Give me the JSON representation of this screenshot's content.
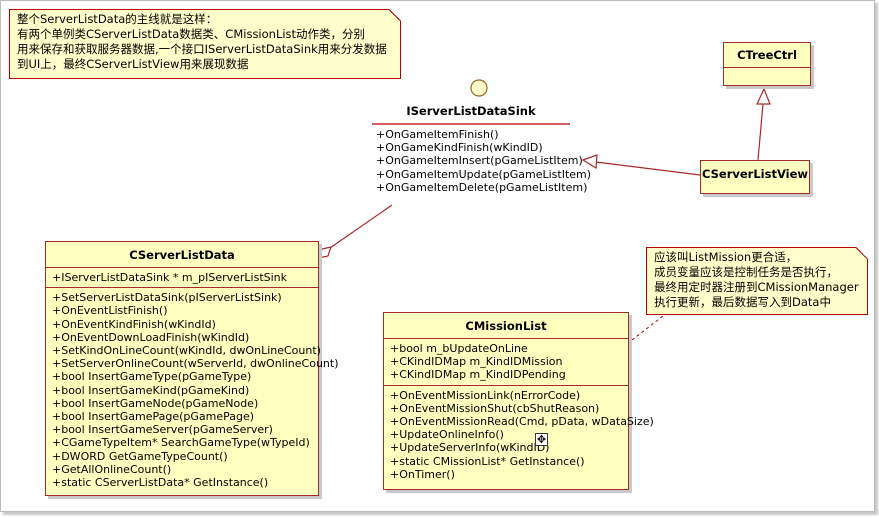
{
  "notes": {
    "summary": [
      "整个ServerListData的主线就是这样：",
      "有两个单例类CServerListData数据类、CMissionList动作类，分别",
      "用来保存和获取服务器数据,一个接口IServerListDataSink用来分发数据",
      "到UI上，最终CServerListView用来展现数据"
    ],
    "mission": [
      "应该叫ListMission更合适，",
      "成员变量应该是控制任务是否执行，",
      "最终用定时器注册到CMissionManager",
      "执行更新，最后数据写入到Data中"
    ]
  },
  "interface": {
    "name": "IServerListDataSink",
    "operations": [
      "+OnGameItemFinish()",
      "+OnGameKindFinish(wKindID)",
      "+OnGameItemInsert(pGameListItem)",
      "+OnGameItemUpdate(pGameListItem)",
      "+OnGameItemDelete(pGameListItem)"
    ]
  },
  "classes": {
    "tree": {
      "name": "CTreeCtrl"
    },
    "view": {
      "name": "CServerListView"
    },
    "data": {
      "name": "CServerListData",
      "attributes": [
        "+IServerListDataSink * m_pIServerListSink"
      ],
      "operations": [
        "+SetServerListDataSink(pIServerListSink)",
        "+OnEventListFinish()",
        "+OnEventKindFinish(wKindId)",
        "+OnEventDownLoadFinish(wKindId)",
        "+SetKindOnLineCount(wKindId, dwOnLineCount)",
        "+SetServerOnlineCount(wServerId, dwOnlineCount)",
        "+bool InsertGameType(pGameType)",
        "+bool InsertGameKind(pGameKind)",
        "+bool InsertGameNode(pGameNode)",
        "+bool InsertGamePage(pGamePage)",
        "+bool InsertGameServer(pGameServer)",
        "+CGameTypeItem* SearchGameType(wTypeId)",
        "+DWORD GetGameTypeCount()",
        "+GetAllOnlineCount()",
        "+static CServerListData* GetInstance()"
      ]
    },
    "mission": {
      "name": "CMissionList",
      "attributes": [
        "+bool m_bUpdateOnLine",
        "+CKindIDMap m_KindIDMission",
        "+CKindIDMap m_KindIDPending"
      ],
      "operations": [
        "+OnEventMissionLink(nErrorCode)",
        "+OnEventMissionShut(cbShutReason)",
        "+OnEventMissionRead(Cmd, pData, wDataSize)",
        "+UpdateOnlineInfo()",
        "+UpdateServerInfo(wKindID)",
        "+static CMissionList* GetInstance()",
        "+OnTimer()"
      ]
    }
  }
}
